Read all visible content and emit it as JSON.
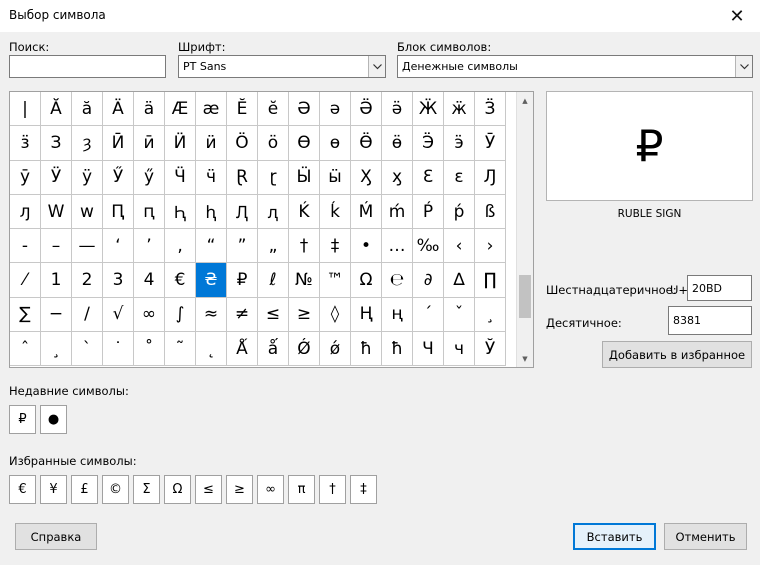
{
  "window": {
    "title": "Выбор символа"
  },
  "search": {
    "label": "Поиск:",
    "value": ""
  },
  "font": {
    "label": "Шрифт:",
    "value": "PT Sans"
  },
  "block": {
    "label": "Блок символов:",
    "value": "Денежные символы"
  },
  "grid": {
    "selected_index": 86,
    "cells": [
      "|",
      "Ă",
      "ă",
      "Ä",
      "ä",
      "Æ",
      "æ",
      "Ĕ",
      "ĕ",
      "Ə",
      "ə",
      "Ӛ",
      "ӛ",
      "Ӝ",
      "ӝ",
      "Ӟ",
      "ӟ",
      "З",
      "ȝ",
      "Ӣ",
      "ӣ",
      "Ӥ",
      "ӥ",
      "Ӧ",
      "ӧ",
      "Ө",
      "ө",
      "Ӫ",
      "ӫ",
      "Ӭ",
      "ӭ",
      "Ӯ",
      "ӯ",
      "Ӱ",
      "ӱ",
      "Ӳ",
      "ӳ",
      "Ӵ",
      "ӵ",
      "Ɽ",
      "ɽ",
      "Ӹ",
      "ӹ",
      "Ӽ",
      "ӽ",
      "Ԑ",
      "ԑ",
      "Ԓ",
      "ԓ",
      "W",
      "w",
      "Ԥ",
      "ԥ",
      "Ԧ",
      "ԧ",
      "Ԯ",
      "ԯ",
      "Ḱ",
      "ḱ",
      "Ḿ",
      "ḿ",
      "Ṕ",
      "ṕ",
      "ß",
      "-",
      "–",
      "—",
      "‘",
      "’",
      "‚",
      "“",
      "”",
      "„",
      "†",
      "‡",
      "•",
      "…",
      "‰",
      "‹",
      "›",
      "⁄",
      "1",
      "2",
      "3",
      "4",
      "€",
      "₴",
      "₽",
      "ℓ",
      "№",
      "™",
      "Ω",
      "℮",
      "∂",
      "∆",
      "∏",
      "∑",
      "−",
      "∕",
      "√",
      "∞",
      "∫",
      "≈",
      "≠",
      "≤",
      "≥",
      "◊",
      "Ң",
      "ң",
      "ˊ",
      "ˇ",
      "¸",
      "ˆ",
      "¸",
      "ˋ",
      "˙",
      "˚",
      "˜",
      "˛",
      "Ǻ",
      "ǻ",
      "Ǿ",
      "ǿ",
      "ħ",
      "ħ",
      "Ч",
      "ч",
      "Ў"
    ]
  },
  "preview": {
    "char": "₽",
    "name": "RUBLE SIGN"
  },
  "hex": {
    "label": "Шестнадцатеричное:",
    "prefix": "U+",
    "value": "20BD"
  },
  "decimal": {
    "label": "Десятичное:",
    "value": "8381"
  },
  "buttons": {
    "add_favorite": "Добавить в избранное",
    "help": "Справка",
    "insert": "Вставить",
    "cancel": "Отменить"
  },
  "recent": {
    "label": "Недавние символы:",
    "items": [
      "₽",
      "●"
    ]
  },
  "favorites": {
    "label": "Избранные символы:",
    "items": [
      "€",
      "¥",
      "£",
      "©",
      "Σ",
      "Ω",
      "≤",
      "≥",
      "∞",
      "π",
      "†",
      "‡"
    ]
  }
}
